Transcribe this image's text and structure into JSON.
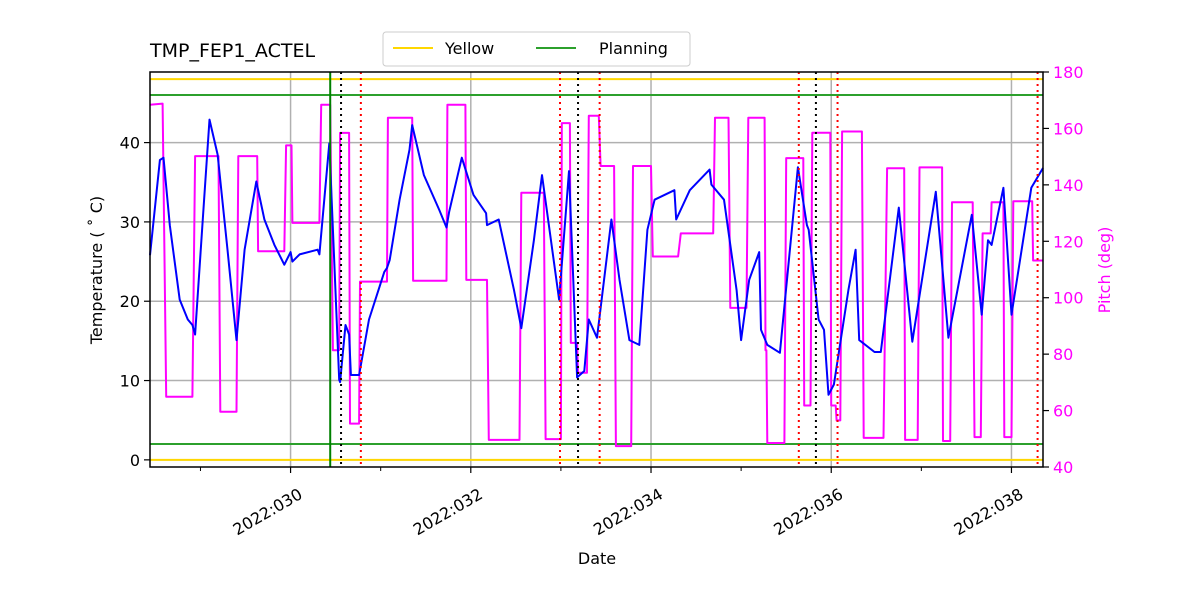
{
  "chart_data": {
    "type": "line",
    "title": "TMP_FEP1_ACTEL",
    "xlabel": "Date",
    "ylabel": "Temperature ($^\\circ$C)",
    "ylabel_display": "Temperature ( ˚ C)",
    "y2label": "Pitch (deg)",
    "xlim": [
      28.44,
      38.35
    ],
    "ylim": [
      -0.9,
      48.9
    ],
    "y2lim": [
      40,
      180
    ],
    "xticks": [
      {
        "value": 30,
        "label": "2022:030"
      },
      {
        "value": 32,
        "label": "2022:032"
      },
      {
        "value": 34,
        "label": "2022:034"
      },
      {
        "value": 36,
        "label": "2022:036"
      },
      {
        "value": 38,
        "label": "2022:038"
      }
    ],
    "xminor_ticks": [
      29,
      31,
      33,
      35,
      37
    ],
    "yticks": [
      0,
      10,
      20,
      30,
      40
    ],
    "y2ticks": [
      40,
      60,
      80,
      100,
      120,
      140,
      160,
      180
    ],
    "grid": true,
    "legend": {
      "placement": "top-center-above",
      "entries": [
        {
          "label": "Yellow",
          "color": "#ffd700"
        },
        {
          "label": "Planning",
          "color": "#2ca02c"
        }
      ]
    },
    "limit_lines": [
      {
        "name": "yellow-high",
        "value": 48.0,
        "color": "#ffd700"
      },
      {
        "name": "planning-high",
        "value": 46.0,
        "color": "#2ca02c"
      },
      {
        "name": "planning-low",
        "value": 2.0,
        "color": "#2ca02c"
      },
      {
        "name": "yellow-low",
        "value": 0.0,
        "color": "#ffd700"
      }
    ],
    "vertical_lines": [
      {
        "name": "now-line",
        "day": 30.44,
        "color": "#008000",
        "style": "solid"
      },
      {
        "name": "black-dotted-1",
        "day": 30.56,
        "color": "#000000",
        "style": "dotted"
      },
      {
        "name": "red-dotted-1",
        "day": 30.78,
        "color": "#ff0000",
        "style": "dotted"
      },
      {
        "name": "red-dotted-2",
        "day": 32.99,
        "color": "#ff0000",
        "style": "dotted"
      },
      {
        "name": "black-dotted-2",
        "day": 33.19,
        "color": "#000000",
        "style": "dotted"
      },
      {
        "name": "red-dotted-3",
        "day": 33.43,
        "color": "#ff0000",
        "style": "dotted"
      },
      {
        "name": "red-dotted-4",
        "day": 35.64,
        "color": "#ff0000",
        "style": "dotted"
      },
      {
        "name": "black-dotted-3",
        "day": 35.83,
        "color": "#000000",
        "style": "dotted"
      },
      {
        "name": "red-dotted-5",
        "day": 36.07,
        "color": "#ff0000",
        "style": "dotted"
      },
      {
        "name": "red-dotted-6",
        "day": 38.29,
        "color": "#ff0000",
        "style": "dotted"
      }
    ],
    "series": [
      {
        "name": "Temperature",
        "axis": "left",
        "color": "#0000ff",
        "points": [
          [
            28.44,
            25.8
          ],
          [
            28.55,
            37.8
          ],
          [
            28.59,
            38.1
          ],
          [
            28.66,
            29.6
          ],
          [
            28.77,
            20.2
          ],
          [
            28.86,
            17.7
          ],
          [
            28.91,
            17.0
          ],
          [
            28.94,
            15.8
          ],
          [
            29.04,
            32.8
          ],
          [
            29.1,
            42.9
          ],
          [
            29.19,
            38.5
          ],
          [
            29.3,
            26.5
          ],
          [
            29.4,
            15.1
          ],
          [
            29.49,
            26.5
          ],
          [
            29.62,
            35.1
          ],
          [
            29.71,
            30.3
          ],
          [
            29.82,
            27.1
          ],
          [
            29.93,
            24.6
          ],
          [
            30.0,
            26.2
          ],
          [
            30.02,
            25.0
          ],
          [
            30.1,
            25.9
          ],
          [
            30.3,
            26.5
          ],
          [
            30.32,
            25.9
          ],
          [
            30.43,
            39.9
          ],
          [
            30.54,
            10.1
          ],
          [
            30.55,
            9.8
          ],
          [
            30.61,
            17.0
          ],
          [
            30.65,
            15.8
          ],
          [
            30.67,
            10.7
          ],
          [
            30.76,
            10.7
          ],
          [
            30.87,
            17.7
          ],
          [
            31.04,
            23.7
          ],
          [
            31.07,
            24.2
          ],
          [
            31.1,
            25.2
          ],
          [
            31.21,
            32.8
          ],
          [
            31.32,
            39.1
          ],
          [
            31.35,
            42.2
          ],
          [
            31.48,
            35.9
          ],
          [
            31.65,
            31.5
          ],
          [
            31.73,
            29.3
          ],
          [
            31.76,
            31.3
          ],
          [
            31.9,
            38.1
          ],
          [
            32.03,
            33.4
          ],
          [
            32.17,
            31.1
          ],
          [
            32.18,
            29.6
          ],
          [
            32.31,
            30.3
          ],
          [
            32.48,
            21.4
          ],
          [
            32.56,
            16.6
          ],
          [
            32.7,
            27.7
          ],
          [
            32.79,
            35.9
          ],
          [
            32.98,
            20.2
          ],
          [
            33.09,
            36.4
          ],
          [
            33.18,
            10.4
          ],
          [
            33.26,
            11.2
          ],
          [
            33.31,
            17.7
          ],
          [
            33.4,
            15.4
          ],
          [
            33.56,
            30.3
          ],
          [
            33.65,
            22.7
          ],
          [
            33.76,
            15.1
          ],
          [
            33.87,
            14.5
          ],
          [
            33.96,
            29.0
          ],
          [
            34.04,
            32.8
          ],
          [
            34.26,
            34.0
          ],
          [
            34.28,
            30.3
          ],
          [
            34.43,
            34.0
          ],
          [
            34.65,
            36.6
          ],
          [
            34.67,
            34.7
          ],
          [
            34.81,
            32.8
          ],
          [
            34.95,
            21.4
          ],
          [
            35.0,
            15.1
          ],
          [
            35.09,
            22.7
          ],
          [
            35.2,
            26.2
          ],
          [
            35.22,
            16.4
          ],
          [
            35.29,
            14.5
          ],
          [
            35.43,
            13.5
          ],
          [
            35.63,
            36.9
          ],
          [
            35.73,
            29.6
          ],
          [
            35.75,
            29.0
          ],
          [
            35.86,
            17.7
          ],
          [
            35.92,
            16.4
          ],
          [
            35.97,
            8.2
          ],
          [
            36.03,
            9.5
          ],
          [
            36.19,
            21.4
          ],
          [
            36.27,
            26.5
          ],
          [
            36.31,
            15.1
          ],
          [
            36.48,
            13.6
          ],
          [
            36.55,
            13.6
          ],
          [
            36.75,
            31.8
          ],
          [
            36.9,
            14.9
          ],
          [
            37.16,
            33.8
          ],
          [
            37.3,
            15.4
          ],
          [
            37.56,
            30.9
          ],
          [
            37.67,
            18.3
          ],
          [
            37.74,
            27.7
          ],
          [
            37.78,
            27.1
          ],
          [
            37.91,
            34.3
          ],
          [
            38.0,
            18.3
          ],
          [
            38.22,
            34.3
          ],
          [
            38.35,
            36.8
          ]
        ]
      },
      {
        "name": "Pitch",
        "axis": "right",
        "color": "#ff00ff",
        "steps": [
          [
            28.44,
            168.4
          ],
          [
            28.58,
            168.8
          ],
          [
            28.62,
            64.9
          ],
          [
            28.91,
            64.9
          ],
          [
            28.94,
            150.2
          ],
          [
            29.2,
            150.2
          ],
          [
            29.22,
            59.6
          ],
          [
            29.4,
            59.6
          ],
          [
            29.42,
            150.2
          ],
          [
            29.63,
            150.2
          ],
          [
            29.64,
            116.5
          ],
          [
            29.93,
            116.5
          ],
          [
            29.95,
            154.0
          ],
          [
            30.01,
            154.0
          ],
          [
            30.02,
            126.5
          ],
          [
            30.32,
            126.5
          ],
          [
            30.34,
            168.4
          ],
          [
            30.44,
            168.4
          ],
          [
            30.47,
            81.4
          ],
          [
            30.54,
            81.4
          ],
          [
            30.55,
            158.4
          ],
          [
            30.65,
            158.4
          ],
          [
            30.66,
            55.4
          ],
          [
            30.76,
            55.4
          ],
          [
            30.77,
            105.7
          ],
          [
            31.07,
            105.7
          ],
          [
            31.08,
            163.8
          ],
          [
            31.35,
            163.8
          ],
          [
            31.36,
            106.0
          ],
          [
            31.73,
            106.0
          ],
          [
            31.74,
            168.4
          ],
          [
            31.94,
            168.4
          ],
          [
            31.95,
            106.3
          ],
          [
            32.18,
            106.3
          ],
          [
            32.2,
            49.6
          ],
          [
            32.54,
            49.6
          ],
          [
            32.56,
            137.2
          ],
          [
            32.81,
            137.2
          ],
          [
            32.83,
            49.9
          ],
          [
            33.0,
            49.9
          ],
          [
            33.01,
            161.9
          ],
          [
            33.1,
            161.9
          ],
          [
            33.11,
            84.0
          ],
          [
            33.18,
            84.0
          ],
          [
            33.19,
            73.4
          ],
          [
            33.29,
            73.4
          ],
          [
            33.31,
            164.5
          ],
          [
            33.42,
            164.5
          ],
          [
            33.44,
            146.7
          ],
          [
            33.59,
            146.7
          ],
          [
            33.61,
            47.4
          ],
          [
            33.78,
            47.4
          ],
          [
            33.8,
            146.7
          ],
          [
            34.0,
            146.7
          ],
          [
            34.02,
            114.6
          ],
          [
            34.3,
            114.6
          ],
          [
            34.33,
            122.8
          ],
          [
            34.69,
            122.8
          ],
          [
            34.71,
            163.8
          ],
          [
            34.86,
            163.8
          ],
          [
            34.88,
            96.4
          ],
          [
            35.06,
            96.4
          ],
          [
            35.08,
            163.8
          ],
          [
            35.26,
            163.8
          ],
          [
            35.27,
            81.4
          ],
          [
            35.28,
            81.4
          ],
          [
            35.29,
            48.5
          ],
          [
            35.48,
            48.5
          ],
          [
            35.5,
            149.5
          ],
          [
            35.69,
            149.5
          ],
          [
            35.7,
            61.8
          ],
          [
            35.77,
            61.8
          ],
          [
            35.79,
            158.5
          ],
          [
            35.99,
            158.5
          ],
          [
            36.0,
            61.8
          ],
          [
            36.05,
            61.8
          ],
          [
            36.06,
            56.5
          ],
          [
            36.1,
            56.5
          ],
          [
            36.12,
            158.9
          ],
          [
            36.34,
            158.9
          ],
          [
            36.36,
            50.3
          ],
          [
            36.58,
            50.3
          ],
          [
            36.62,
            145.9
          ],
          [
            36.81,
            145.9
          ],
          [
            36.82,
            49.6
          ],
          [
            36.96,
            49.6
          ],
          [
            36.98,
            146.2
          ],
          [
            37.23,
            146.2
          ],
          [
            37.24,
            49.2
          ],
          [
            37.32,
            49.2
          ],
          [
            37.34,
            133.8
          ],
          [
            37.57,
            133.8
          ],
          [
            37.59,
            50.6
          ],
          [
            37.66,
            50.6
          ],
          [
            37.68,
            122.8
          ],
          [
            37.77,
            122.8
          ],
          [
            37.78,
            133.8
          ],
          [
            37.91,
            133.8
          ],
          [
            37.92,
            50.6
          ],
          [
            38.0,
            50.6
          ],
          [
            38.02,
            134.2
          ],
          [
            38.23,
            134.2
          ],
          [
            38.24,
            113.2
          ],
          [
            38.35,
            113.2
          ]
        ]
      }
    ]
  }
}
